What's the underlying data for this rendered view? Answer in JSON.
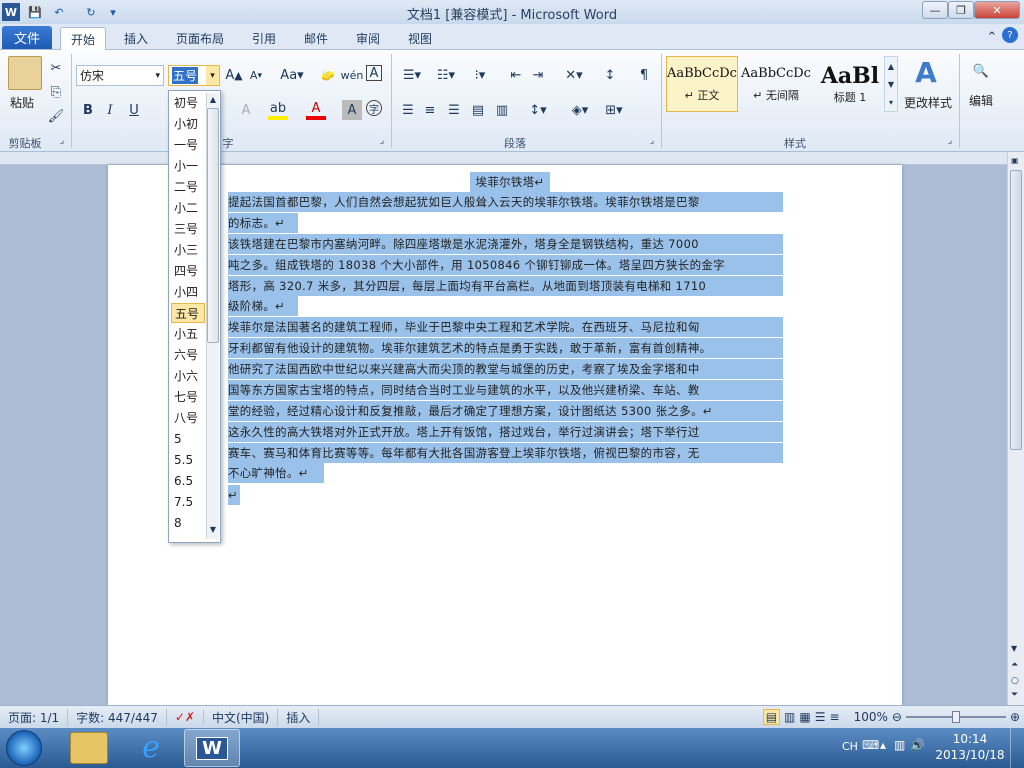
{
  "window": {
    "title": "文档1 [兼容模式] - Microsoft Word",
    "buttons": {
      "min": "—",
      "restore": "❐",
      "close": "✕"
    }
  },
  "tabs": [
    "文件",
    "开始",
    "插入",
    "页面布局",
    "引用",
    "邮件",
    "审阅",
    "视图"
  ],
  "active_tab": "开始",
  "ribbon": {
    "clipboard": {
      "paste": "粘贴",
      "label": "剪贴板"
    },
    "font": {
      "name": "仿宋",
      "size": "五号",
      "label": "字体"
    },
    "paragraph_label": "段落",
    "styles": {
      "label": "样式",
      "items": [
        {
          "preview": "AaBbCcDc",
          "name": "↵ 正文"
        },
        {
          "preview": "AaBbCcDc",
          "name": "↵ 无间隔"
        },
        {
          "preview": "AaBl",
          "name": "标题 1"
        }
      ],
      "change": "更改样式"
    },
    "edit": "编辑"
  },
  "font_size_dropdown": {
    "items": [
      "初号",
      "小初",
      "一号",
      "小一",
      "二号",
      "小二",
      "三号",
      "小三",
      "四号",
      "小四",
      "五号",
      "小五",
      "六号",
      "小六",
      "七号",
      "八号",
      "5",
      "5.5",
      "6.5",
      "7.5",
      "8"
    ],
    "selected": "五号"
  },
  "document": {
    "lines": [
      "埃菲尔铁塔↵",
      "提起法国首都巴黎，人们自然会想起犹如巨人般耸入云天的埃菲尔铁塔。埃菲尔铁塔是巴黎",
      "的标志。↵",
      "该铁塔建在巴黎市内塞纳河畔。除四座塔墩是水泥浇灌外，塔身全是钢铁结构，重达 7000",
      "吨之多。组成铁塔的 18038 个大小部件，用 1050846 个铆钉铆成一体。塔呈四方狭长的金字",
      "塔形，高 320.7 米多，其分四层，每层上面均有平台高栏。从地面到塔顶装有电梯和 1710",
      "级阶梯。↵",
      "埃菲尔是法国著名的建筑工程师，毕业于巴黎中央工程和艺术学院。在西班牙、马尼拉和匈",
      "牙利都留有他设计的建筑物。埃菲尔建筑艺术的特点是勇于实践，敢于革新，富有首创精神。",
      "他研究了法国西欧中世纪以来兴建高大而尖顶的教堂与城堡的历史，考察了埃及金字塔和中",
      "国等东方国家古宝塔的特点，同时结合当时工业与建筑的水平，以及他兴建桥梁、车站、教",
      "堂的经验，经过精心设计和反复推敲，最后才确定了理想方案，设计图纸达 5300 张之多。↵",
      "这永久性的高大铁塔对外正式开放。塔上开有饭馆，搭过戏台，举行过演讲会；塔下举行过",
      "赛车、赛马和体育比赛等等。每年都有大批各国游客登上埃菲尔铁塔，俯视巴黎的市容，无",
      "不心旷神怡。↵",
      "↵"
    ]
  },
  "status": {
    "page": "页面: 1/1",
    "words": "字数: 447/447",
    "lang": "中文(中国)",
    "mode": "插入",
    "zoom": "100%"
  },
  "taskbar": {
    "lang": "CH",
    "time": "10:14",
    "date": "2013/10/18"
  }
}
